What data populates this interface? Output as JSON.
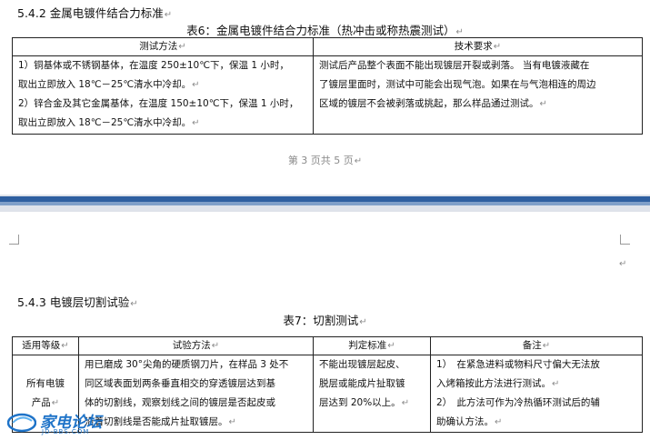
{
  "page1": {
    "section_title": "5.4.2 金属电镀件结合力标准",
    "table_caption": "表6：金属电镀件结合力标准（热冲击或称热震测试）",
    "headers": [
      "测试方法",
      "技术要求"
    ],
    "method_lines": [
      "1）铜基体或不锈钢基体，在温度 250±10℃下，保温 1 小时，",
      "取出立即放入 18℃－25℃清水中冷却。",
      "2）锌合金及其它金属基体，在温度 150±10℃下，保温 1 小时，",
      "取出立即放入 18℃－25℃清水中冷却。"
    ],
    "requirement_lines": [
      "测试后产品整个表面不能出现镀层开裂或剥落。 当有电镀液藏在",
      "了镀层里面时，测试中可能会出现气泡。如果在与气泡相连的周边",
      "区域的镀层不会被剥落或挑起，那么样品通过测试。"
    ],
    "footer": "第 3 页共 5 页"
  },
  "page2": {
    "section_title": "5.4.3 电镀层切割试验",
    "table_caption": "表7：切割测试",
    "headers": [
      "适用等级",
      "试验方法",
      "判定标准",
      "备注"
    ],
    "grade_lines": [
      "所有电镀",
      "产品"
    ],
    "method_lines": [
      "用已磨成 30°尖角的硬质钢刀片，在样品 3 处不",
      "同区域表面划两条垂直相交的穿透镀层达到基",
      "体的切割线，观察划线之间的镀层是否起皮或",
      "沿着切割线是否能成片扯取镀层。"
    ],
    "criteria_lines": [
      "不能出现镀层起皮、",
      "脱层或能成片扯取镀",
      "层达到 20%以上。"
    ],
    "remark_lines": [
      "1）　在紧急进料或物料尺寸偏大无法放",
      "入烤箱按此方法进行测试。",
      "2）　此方法可作为冷热循环测试后的辅",
      "助确认方法。"
    ]
  },
  "watermark": {
    "logo_text": "家电论坛",
    "logo_sub": "JD-BBS.COM"
  },
  "colors": {
    "band": "#2e5fa0",
    "logo": "#1e73c8"
  }
}
